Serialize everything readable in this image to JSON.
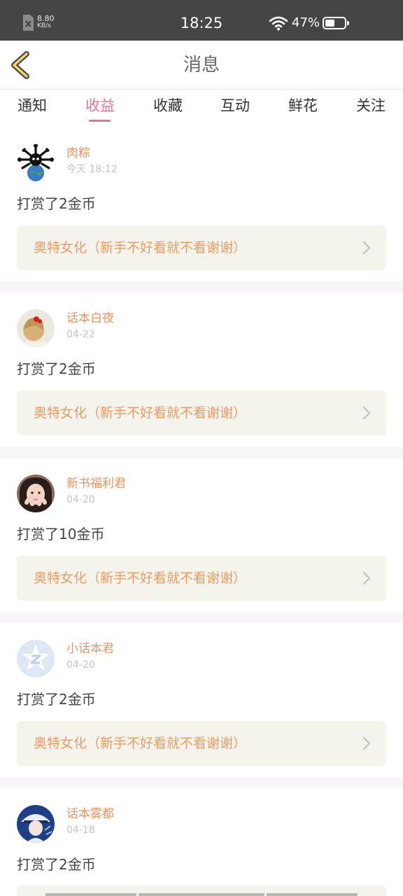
{
  "status_bar": {
    "speed_value": "8.80",
    "speed_unit": "KB/s",
    "time": "18:25",
    "battery": "47%"
  },
  "header": {
    "title": "消息",
    "back_icon": "chevron-left-icon"
  },
  "tabs": [
    {
      "label": "通知",
      "active": false
    },
    {
      "label": "收益",
      "active": true
    },
    {
      "label": "收藏",
      "active": false
    },
    {
      "label": "互动",
      "active": false
    },
    {
      "label": "鲜花",
      "active": false
    },
    {
      "label": "关注",
      "active": false
    }
  ],
  "colors": {
    "accent": "#e8719c",
    "name": "#e8935e",
    "work": "#ee9a64",
    "work_bg": "#f5f4ec"
  },
  "messages": [
    {
      "user": "肉粽",
      "time": "今天 18:12",
      "text": "打赏了2金币",
      "work": "奥特女化（新手不好看就不看谢谢）"
    },
    {
      "user": "话本白夜",
      "time": "04-22",
      "text": "打赏了2金币",
      "work": "奥特女化（新手不好看就不看谢谢）"
    },
    {
      "user": "新书福利君",
      "time": "04-20",
      "text": "打赏了10金币",
      "work": "奥特女化（新手不好看就不看谢谢）"
    },
    {
      "user": "小话本君",
      "time": "04-20",
      "text": "打赏了2金币",
      "work": "奥特女化（新手不好看就不看谢谢）"
    },
    {
      "user": "话本雾都",
      "time": "04-18",
      "text": "打赏了2金币",
      "work": ""
    }
  ]
}
